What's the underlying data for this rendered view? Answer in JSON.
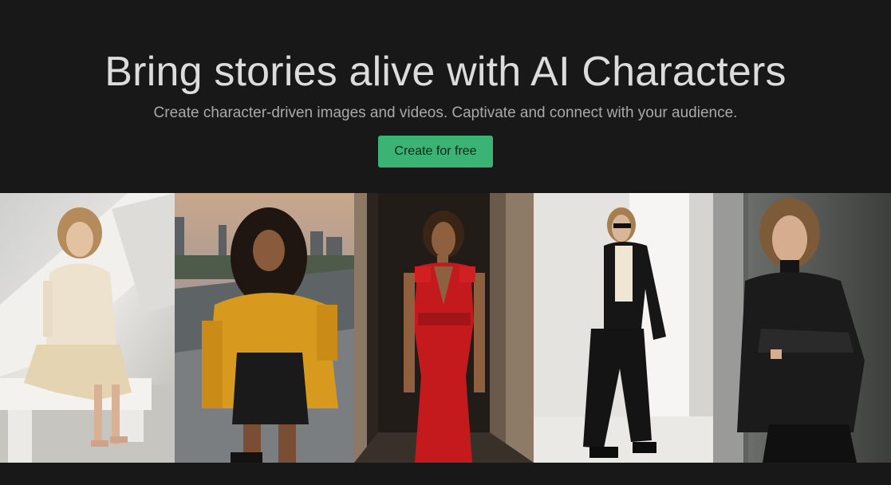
{
  "hero": {
    "title": "Bring stories alive with AI Characters",
    "subtitle": "Create character-driven images and videos. Captivate and connect with your audience.",
    "cta_label": "Create for free"
  },
  "colors": {
    "background": "#181818",
    "title_text": "#dcdcdc",
    "subtitle_text": "#a9a9a9",
    "cta_background": "#3bb375"
  },
  "gallery": {
    "photos": [
      {
        "subject": "woman in cream knit top and skirt seated on white bench"
      },
      {
        "subject": "woman in mustard sweater and black leather skirt on rooftop at dusk"
      },
      {
        "subject": "woman in red v-neck dress in dark corridor"
      },
      {
        "subject": "woman in black suit and sunglasses leaning on white wall"
      },
      {
        "subject": "woman in black leather jacket leaning on concrete wall"
      }
    ]
  }
}
